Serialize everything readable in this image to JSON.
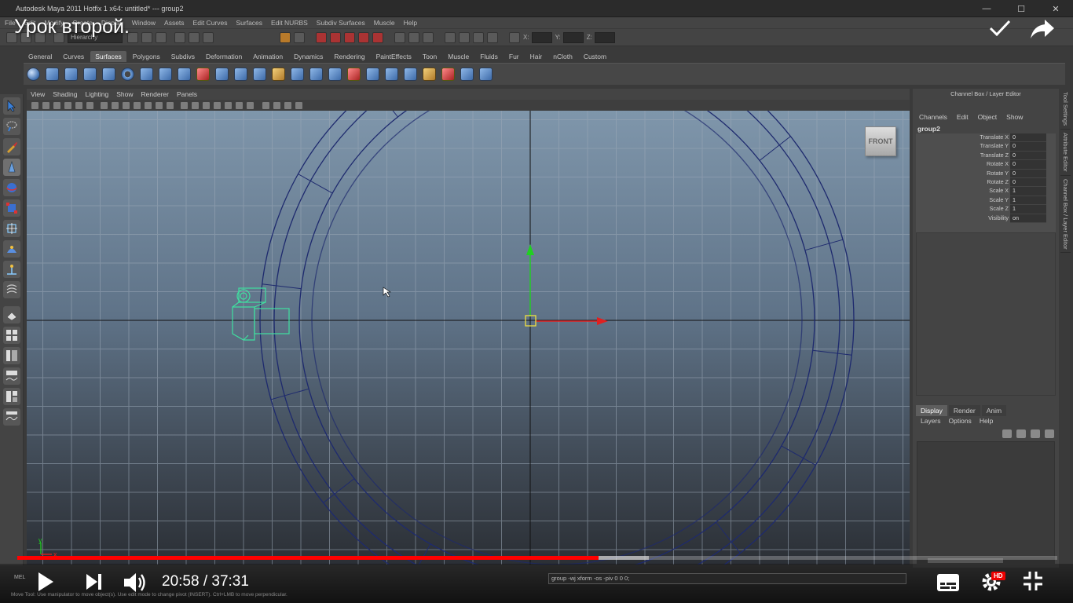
{
  "window": {
    "title": "Autodesk Maya 2011 Hotfix 1 x64: untitled*   ---   group2",
    "controls": {
      "minimize": "—",
      "maximize": "☐",
      "close": "✕"
    }
  },
  "menubar": [
    "File",
    "Edit",
    "Modify",
    "Create",
    "Display",
    "Window",
    "Assets",
    "Edit Curves",
    "Surfaces",
    "Edit NURBS",
    "Subdiv Surfaces",
    "Muscle",
    "Help"
  ],
  "status_line": {
    "selection_mode": "Hierarchy",
    "axis_labels": {
      "x": "X:",
      "y": "Y:",
      "z": "Z:"
    }
  },
  "shelf_tabs": {
    "active": "Surfaces",
    "items": [
      "General",
      "Curves",
      "Surfaces",
      "Polygons",
      "Subdivs",
      "Deformation",
      "Animation",
      "Dynamics",
      "Rendering",
      "PaintEffects",
      "Toon",
      "Muscle",
      "Fluids",
      "Fur",
      "Hair",
      "nCloth",
      "Custom"
    ]
  },
  "viewport_menu": [
    "View",
    "Shading",
    "Lighting",
    "Show",
    "Renderer",
    "Panels"
  ],
  "viewcube": {
    "label": "FRONT"
  },
  "viewport_axis": {
    "y_label": "y",
    "x_label": "x"
  },
  "channel_box": {
    "header": "Channel Box / Layer Editor",
    "menu": [
      "Channels",
      "Edit",
      "Object",
      "Show"
    ],
    "object_name": "group2",
    "channels": [
      {
        "name": "Translate X",
        "value": "0"
      },
      {
        "name": "Translate Y",
        "value": "0"
      },
      {
        "name": "Translate Z",
        "value": "0"
      },
      {
        "name": "Rotate X",
        "value": "0"
      },
      {
        "name": "Rotate Y",
        "value": "0"
      },
      {
        "name": "Rotate Z",
        "value": "0"
      },
      {
        "name": "Scale X",
        "value": "1"
      },
      {
        "name": "Scale Y",
        "value": "1"
      },
      {
        "name": "Scale Z",
        "value": "1"
      },
      {
        "name": "Visibility",
        "value": "on"
      }
    ]
  },
  "layer_editor": {
    "tabs": [
      "Display",
      "Render",
      "Anim"
    ],
    "active_tab": "Display",
    "menu": [
      "Layers",
      "Options",
      "Help"
    ]
  },
  "side_tabs": [
    "Tool Settings",
    "Attribute Editor",
    "Channel Box / Layer Editor"
  ],
  "command_line": {
    "label": "MEL",
    "value": "group -wj xform -os -piv 0 0 0;",
    "help": "Move Tool: Use manipulator to move object(s). Use edit mode to change pivot (INSERT). Ctrl+LMB to move perpendicular."
  },
  "video": {
    "title": "Урок второй.",
    "current_time": "20:58",
    "duration": "37:31",
    "time_display": "20:58 / 37:31",
    "played_fraction": 0.559,
    "buffered_fraction": 0.607,
    "hd_badge": "HD",
    "colors": {
      "progress": "#ff0000",
      "text": "#ffffff"
    }
  },
  "colors": {
    "ui_bg": "#444444",
    "viewport_top": "#7f96ab",
    "viewport_bottom": "#2b2f35",
    "curve": "#1e2a6e",
    "selection": "#3fe0a0",
    "manip_x": "#e02020",
    "manip_y": "#20d020",
    "manip_center": "#f0e040"
  }
}
